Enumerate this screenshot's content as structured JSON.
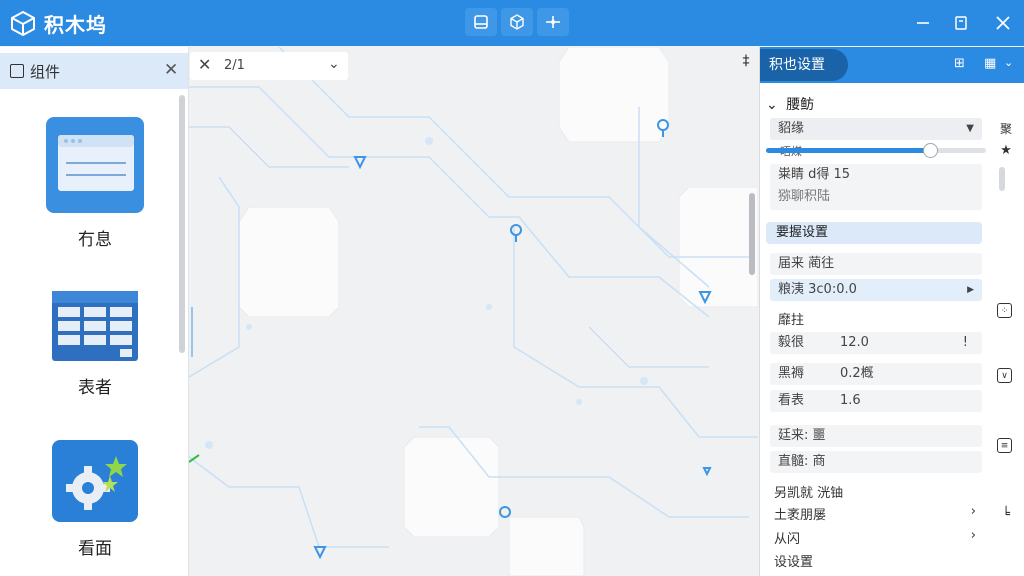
{
  "app": {
    "title": "积木坞"
  },
  "toolbar": {
    "icons": [
      "layout-icon",
      "cube-icon",
      "connect-icon"
    ]
  },
  "window": {
    "controls": [
      "minimize-icon",
      "restore-icon",
      "close-icon"
    ]
  },
  "left_panel": {
    "title": "组件",
    "components": [
      {
        "label": "冇息",
        "icon": "window-icon"
      },
      {
        "label": "表者",
        "icon": "table-icon"
      },
      {
        "label": "看面",
        "icon": "gear-icon"
      }
    ]
  },
  "editor_tab": {
    "name": "2/1"
  },
  "properties": {
    "tab": "积也设置",
    "header_icons": [
      "layout-grid-icon",
      "settings-icon"
    ],
    "section": "腰鲂",
    "dropdown": "貂缘",
    "slider": {
      "label": "晤煤",
      "fraction": 0.74
    },
    "field_line": "粜睛 d得 15",
    "field_line2": "猕聊积陆",
    "sub_section": "要握设置",
    "row1": "届来 蔺往",
    "row2": "粮洟 3c0:0.0",
    "row3_label": "靡拄",
    "row4_label": "毅很",
    "row4_value": "12.0",
    "row5_label": "黑褥",
    "row5_value": "0.2槪",
    "row6_label": "看表",
    "row6_value": "1.6",
    "row7": "廷来: 噩",
    "row8": "直髓: 商",
    "row9": "另凯就  洸铀",
    "row10": "土袤朋屡",
    "row11": "从闪",
    "row12": "设设置"
  },
  "side_bar": {
    "label": "聚",
    "icons": [
      "star-icon",
      "grid-icon",
      "checkbox-icon",
      "list-icon",
      "tree-icon"
    ]
  },
  "colors": {
    "accent": "#2b8ae2",
    "accent_dark": "#1a63a8",
    "selection": "#dbe9f9"
  }
}
